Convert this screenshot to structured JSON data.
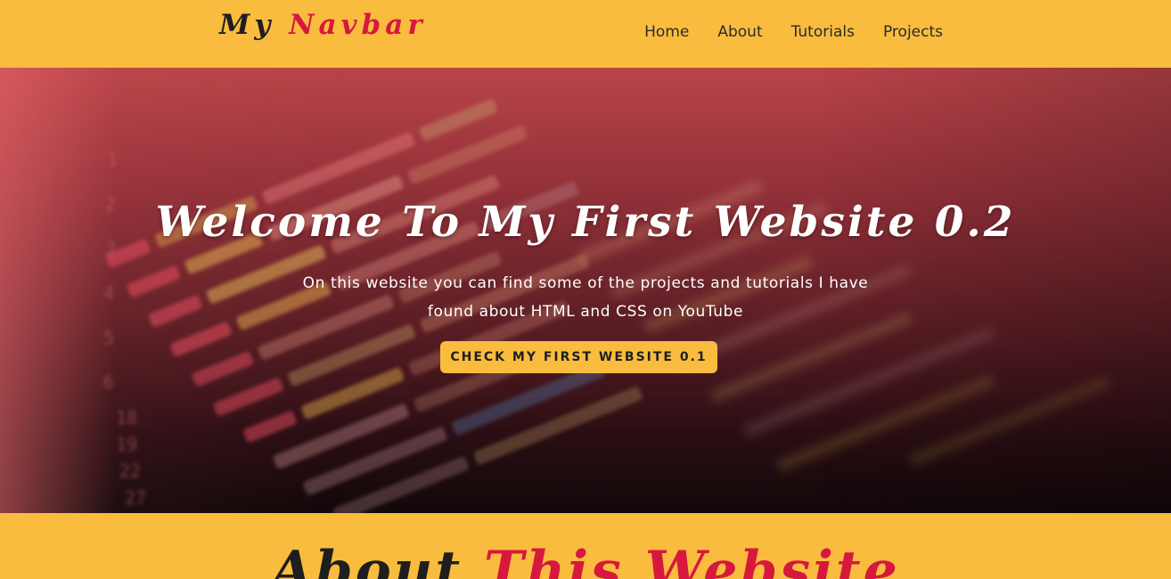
{
  "navbar": {
    "logo_part1": "My",
    "logo_part2": "Navbar",
    "links": [
      "Home",
      "About",
      "Tutorials",
      "Projects"
    ]
  },
  "hero": {
    "title": "Welcome To My First Website 0.2",
    "description": "On this website you can find some of the projects and tutorials I have found about HTML and CSS on YouTube",
    "button_label": "CHECK MY FIRST WEBSITE 0.1",
    "background_image": "blurred-code-editor-photo"
  },
  "about": {
    "title_part1": "About",
    "title_part2": "This Website"
  },
  "colors": {
    "accent": "#f9bc3e",
    "brand_red": "#d8173f",
    "dark_text": "#1e1e1e"
  }
}
